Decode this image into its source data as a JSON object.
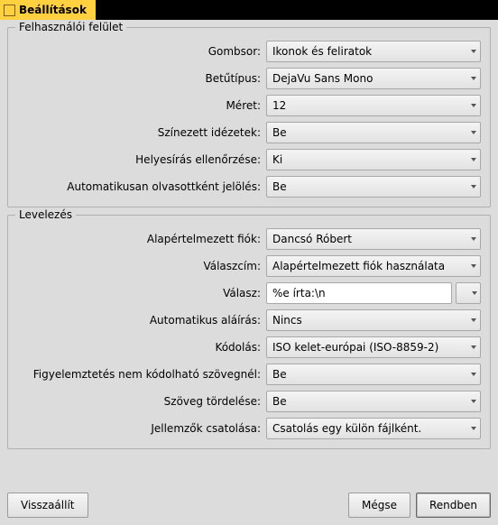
{
  "title": "Beállítások",
  "groups": {
    "ui": {
      "title": "Felhasználói felület",
      "rows": {
        "toolbar": {
          "label": "Gombsor:",
          "value": "Ikonok és feliratok"
        },
        "font": {
          "label": "Betűtípus:",
          "value": "DejaVu Sans Mono"
        },
        "size": {
          "label": "Méret:",
          "value": "12"
        },
        "quotes": {
          "label": "Színezett idézetek:",
          "value": "Be"
        },
        "spell": {
          "label": "Helyesírás ellenőrzése:",
          "value": "Ki"
        },
        "autoread": {
          "label": "Automatikusan olvasottként jelölés:",
          "value": "Be"
        }
      }
    },
    "mail": {
      "title": "Levelezés",
      "rows": {
        "account": {
          "label": "Alapértelmezett fiók:",
          "value": "Dancsó Róbert"
        },
        "replyto": {
          "label": "Válaszcím:",
          "value": "Alapértelmezett fiók használata"
        },
        "reply": {
          "label": "Válasz:",
          "value": "%e írta:\\n"
        },
        "autosig": {
          "label": "Automatikus aláírás:",
          "value": "Nincs"
        },
        "encoding": {
          "label": "Kódolás:",
          "value": "ISO kelet-európai (ISO-8859-2)"
        },
        "warn": {
          "label": "Figyelemztetés nem kódolható szövegnél:",
          "value": "Be"
        },
        "wrap": {
          "label": "Szöveg tördelése:",
          "value": "Be"
        },
        "attach": {
          "label": "Jellemzők csatolása:",
          "value": "Csatolás egy külön fájlként."
        }
      }
    }
  },
  "buttons": {
    "reset": "Visszaállít",
    "cancel": "Mégse",
    "ok": "Rendben"
  }
}
